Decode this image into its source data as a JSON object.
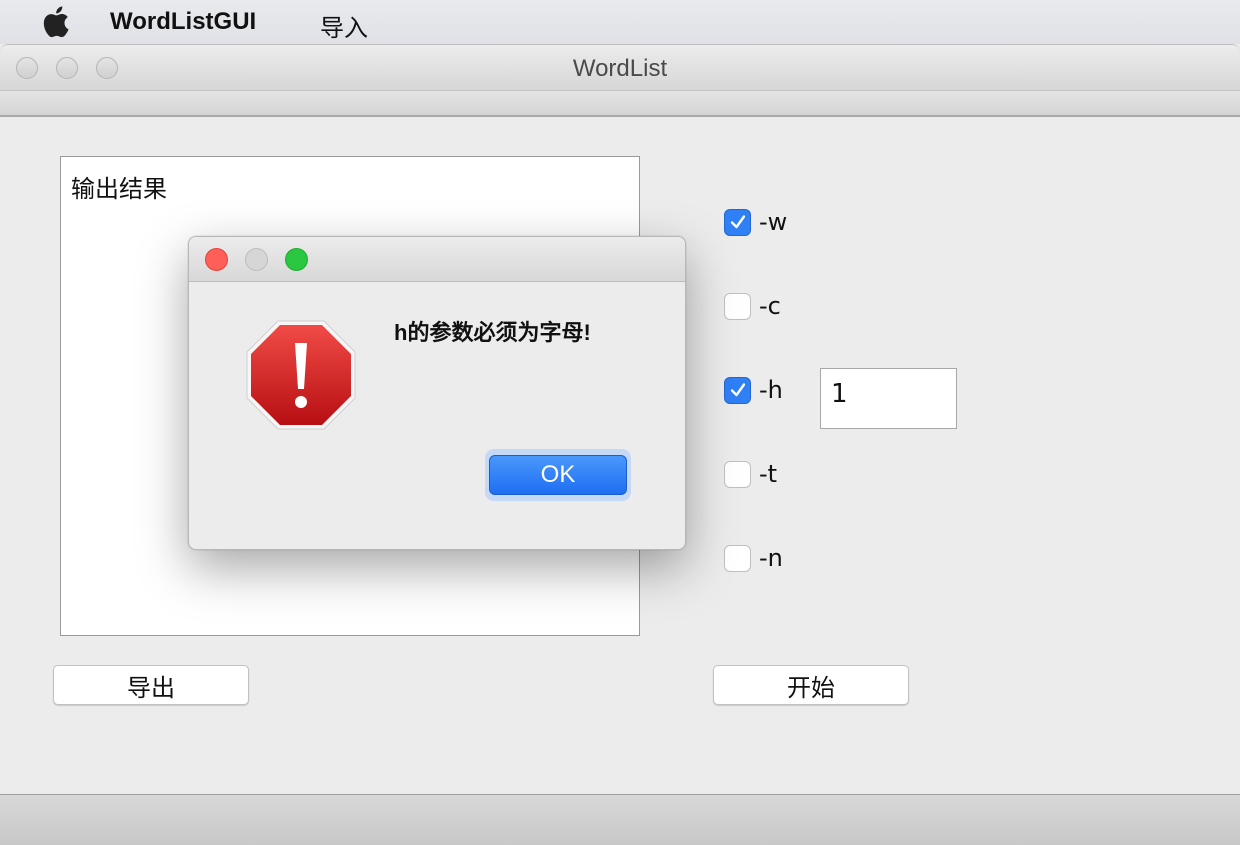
{
  "menubar": {
    "app_name": "WordListGUI",
    "menus": [
      "导入"
    ]
  },
  "window": {
    "title": "WordList"
  },
  "output": {
    "text": "输出结果"
  },
  "buttons": {
    "export_label": "导出",
    "start_label": "开始"
  },
  "options": [
    {
      "label": "-w",
      "checked": true
    },
    {
      "label": "-c",
      "checked": false
    },
    {
      "label": "-h",
      "checked": true
    },
    {
      "label": "-t",
      "checked": false
    },
    {
      "label": "-n",
      "checked": false
    }
  ],
  "h_param": {
    "value": "1"
  },
  "dialog": {
    "message": "h的参数必须为字母!",
    "ok_label": "OK",
    "icon": "stop-alert-icon"
  },
  "colors": {
    "accent": "#1e6ef2",
    "close": "#fe5f57",
    "zoom": "#2ac840",
    "alert_red": "#c4171a"
  }
}
